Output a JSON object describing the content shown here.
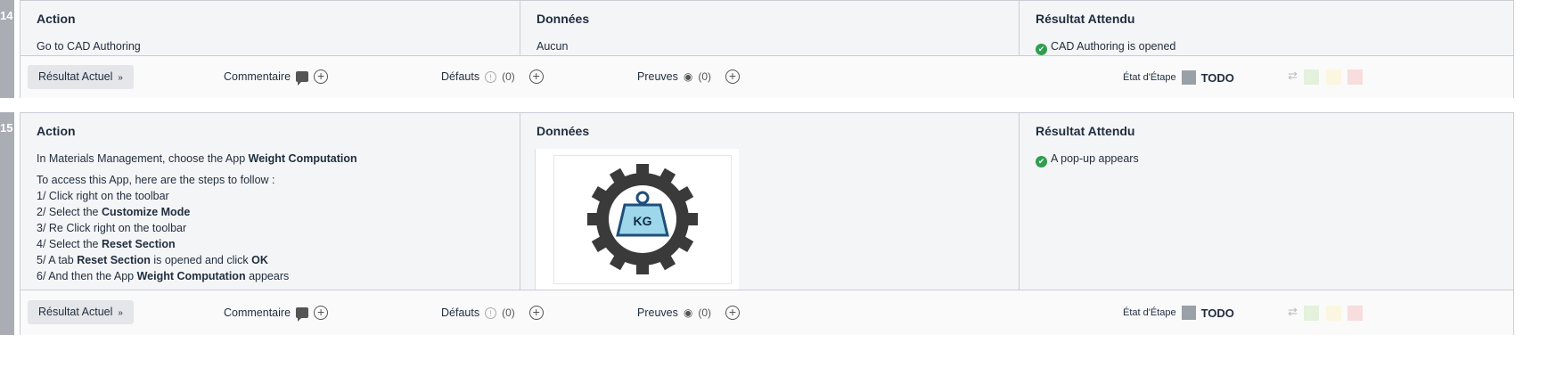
{
  "steps": [
    {
      "number": "14",
      "action_header": "Action",
      "data_header": "Données",
      "expected_header": "Résultat Attendu",
      "action_text": "Go to CAD Authoring",
      "data_text": "Aucun",
      "expected_text": "CAD Authoring is opened",
      "footer": {
        "result_button": "Résultat Actuel",
        "comment_label": "Commentaire",
        "defects_label": "Défauts",
        "defects_count": "(0)",
        "proofs_label": "Preuves",
        "proofs_count": "(0)",
        "state_label": "État d'Étape",
        "state_value": "TODO"
      }
    },
    {
      "number": "15",
      "action_header": "Action",
      "data_header": "Données",
      "expected_header": "Résultat Attendu",
      "action_intro_prefix": "In Materials Management, choose the App ",
      "action_intro_bold": "Weight Computation",
      "action_steps_intro": "To access this App, here are the steps to follow :",
      "action_line1": "1/ Click right on the toolbar",
      "action_line2_prefix": "2/ Select the ",
      "action_line2_bold": "Customize Mode",
      "action_line3": "3/ Re Click right on the toolbar",
      "action_line4_prefix": "4/ Select the ",
      "action_line4_bold": "Reset Section",
      "action_line5_prefix": "5/ A tab ",
      "action_line5_bold": "Reset Section",
      "action_line5_mid": " is opened and click ",
      "action_line5_bold2": "OK",
      "action_line6_prefix": "6/ And then the App ",
      "action_line6_bold": "Weight Computation",
      "action_line6_suffix": " appears",
      "image_text": "KG",
      "expected_text": "A pop-up appears",
      "footer": {
        "result_button": "Résultat Actuel",
        "comment_label": "Commentaire",
        "defects_label": "Défauts",
        "defects_count": "(0)",
        "proofs_label": "Preuves",
        "proofs_count": "(0)",
        "state_label": "État d'Étape",
        "state_value": "TODO"
      }
    }
  ],
  "colors": {
    "pass": "#e3f1dd",
    "blocked": "#fbf6df",
    "fail": "#f7dddd",
    "check": "#2e9e4f",
    "weight_fill": "#9ed7ea"
  },
  "icons": [
    "check-circle-icon",
    "chevron-down-icon",
    "comment-icon",
    "plus-circle-icon",
    "warning-icon",
    "eye-icon",
    "swap-icon",
    "gear-weight-icon"
  ]
}
